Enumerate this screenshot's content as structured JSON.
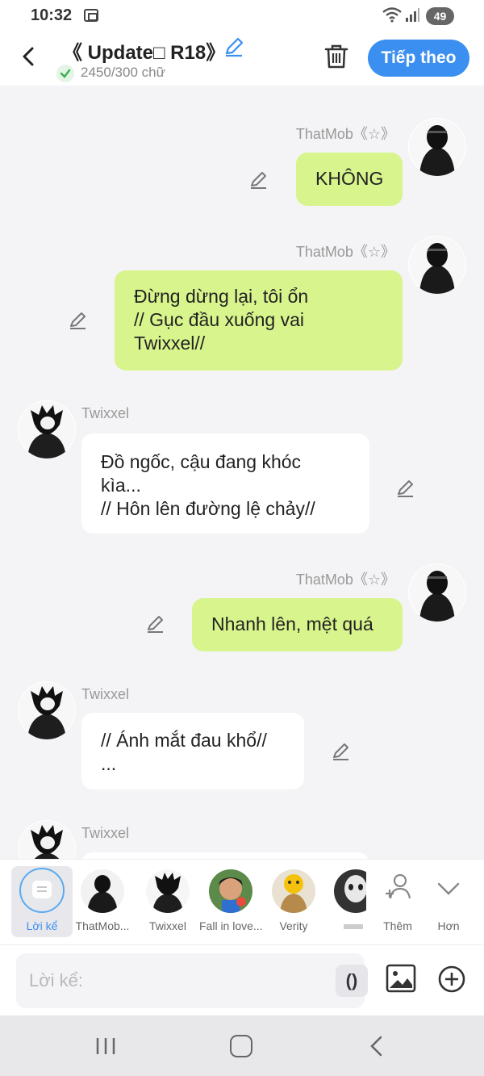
{
  "status_bar": {
    "time": "10:32",
    "battery": "49"
  },
  "header": {
    "title": "《 Update□ R18》",
    "word_count": "2450/300 chữ",
    "next_button": "Tiếp theo"
  },
  "messages": [
    {
      "sender": "ThatMob《☆》",
      "side": "right",
      "lines": [
        "KHÔNG"
      ]
    },
    {
      "sender": "ThatMob《☆》",
      "side": "right",
      "lines": [
        "Đừng dừng lại, tôi ổn",
        "// Gục đầu xuống vai",
        "Twixxel//"
      ]
    },
    {
      "sender": "Twixxel",
      "side": "left",
      "lines": [
        "Đồ ngốc, cậu đang khóc",
        "kìa...",
        "// Hôn lên đường lệ chảy//"
      ]
    },
    {
      "sender": "ThatMob《☆》",
      "side": "right",
      "lines": [
        "Nhanh lên, mệt quá"
      ]
    },
    {
      "sender": "Twixxel",
      "side": "left",
      "lines": [
        "// Ánh mắt đau khổ//",
        "..."
      ]
    },
    {
      "sender": "Twixxel",
      "side": "left",
      "lines": []
    }
  ],
  "characters": {
    "narration": "Lời kể",
    "items": [
      {
        "name": "ThatMob...",
        "icon": "dark-hooded-avatar"
      },
      {
        "name": "Twixxel",
        "icon": "spiky-hair-avatar"
      },
      {
        "name": "Fall in love...",
        "icon": "colorful-boy-avatar"
      },
      {
        "name": "Verity",
        "icon": "yellow-emoji-avatar"
      },
      {
        "name": "",
        "icon": "masked-avatar"
      }
    ],
    "add_label": "Thêm",
    "more_label": "Hơn"
  },
  "input": {
    "placeholder": "Lời kể:",
    "paren_button": "()"
  },
  "colors": {
    "accent": "#3b8ff0",
    "right_bubble": "#d8f48c",
    "left_bubble": "#ffffff"
  }
}
